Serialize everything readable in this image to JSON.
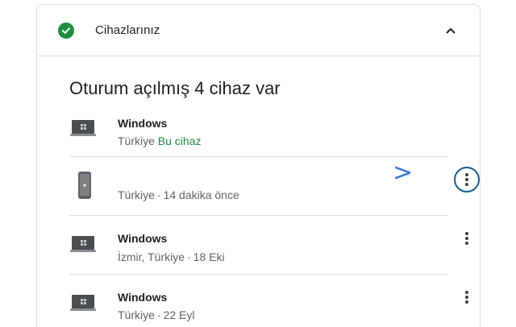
{
  "header": {
    "title": "Cihazlarınız",
    "status_color": "#1e8e3e"
  },
  "section": {
    "title": "Oturum açılmış 4 cihaz var"
  },
  "devices": [
    {
      "name": "Windows",
      "location": "Türkiye",
      "status": "Bu cihaz",
      "icon": "laptop-icon",
      "has_menu": false
    },
    {
      "name": "",
      "location": "Türkiye",
      "status": "14 dakika önce",
      "icon": "phone-icon",
      "has_menu": true
    },
    {
      "name": "Windows",
      "location": "İzmir, Türkiye",
      "status": "18 Eki",
      "icon": "laptop-icon",
      "has_menu": true
    },
    {
      "name": "Windows",
      "location": "Türkiye",
      "status": "22 Eyl",
      "icon": "laptop-icon",
      "has_menu": true
    }
  ],
  "annotation": {
    "arrow": ">",
    "arrow_color": "#3b78d8",
    "circle_color": "#1a5d8f"
  }
}
